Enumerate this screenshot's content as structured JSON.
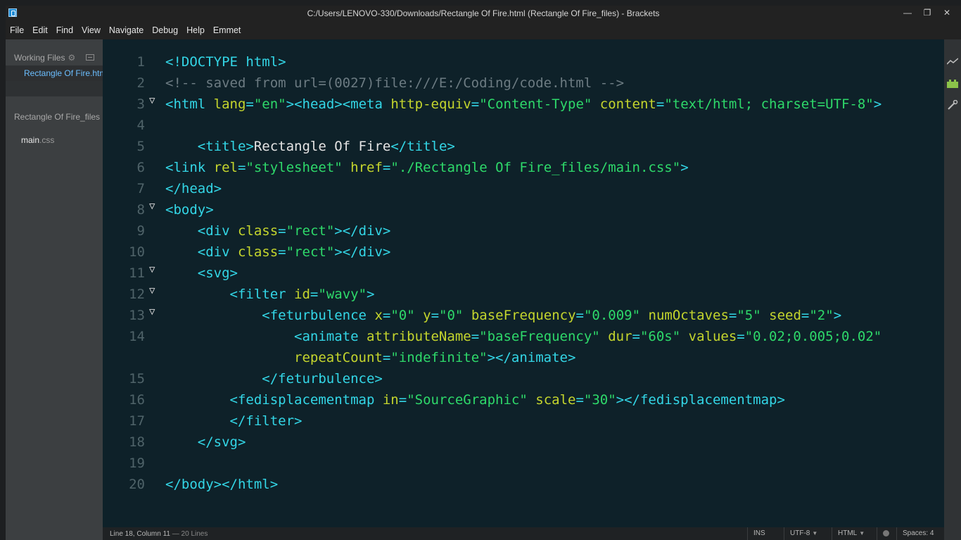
{
  "window": {
    "title": "C:/Users/LENOVO-330/Downloads/Rectangle Of Fire.html (Rectangle Of Fire_files) - Brackets",
    "controls": {
      "minimize": "—",
      "maximize": "❐",
      "close": "✕"
    }
  },
  "menu": {
    "items": [
      "File",
      "Edit",
      "Find",
      "View",
      "Navigate",
      "Debug",
      "Help",
      "Emmet"
    ]
  },
  "sidebar": {
    "working_files_label": "Working Files",
    "working_files": [
      "Rectangle Of Fire.html"
    ],
    "project_title": "Rectangle Of Fire_files",
    "files": [
      {
        "name": "main",
        "ext": ".css"
      }
    ]
  },
  "editor": {
    "lines": [
      {
        "num": "1",
        "fold": "",
        "tokens": [
          [
            "t",
            "<!DOCTYPE html>"
          ]
        ]
      },
      {
        "num": "2",
        "fold": "",
        "tokens": [
          [
            "c",
            "<!-- saved from url=(0027)file:///E:/Coding/code.html -->"
          ]
        ]
      },
      {
        "num": "3",
        "fold": "▽",
        "tokens": [
          [
            "t",
            "<html "
          ],
          [
            "a",
            "lang"
          ],
          [
            "t",
            "="
          ],
          [
            "s",
            "\"en\""
          ],
          [
            "t",
            "><head><meta "
          ],
          [
            "a",
            "http-equiv"
          ],
          [
            "t",
            "="
          ],
          [
            "s",
            "\"Content-Type\""
          ],
          [
            "x",
            " "
          ],
          [
            "a",
            "content"
          ],
          [
            "t",
            "="
          ],
          [
            "s",
            "\"text/html; charset=UTF-8\""
          ],
          [
            "t",
            ">"
          ]
        ]
      },
      {
        "num": "4",
        "fold": "",
        "tokens": []
      },
      {
        "num": "5",
        "fold": "",
        "tokens": [
          [
            "x",
            "    "
          ],
          [
            "t",
            "<title>"
          ],
          [
            "x",
            "Rectangle Of Fire"
          ],
          [
            "t",
            "</title>"
          ]
        ]
      },
      {
        "num": "6",
        "fold": "",
        "tokens": [
          [
            "t",
            "<link "
          ],
          [
            "a",
            "rel"
          ],
          [
            "t",
            "="
          ],
          [
            "s",
            "\"stylesheet\""
          ],
          [
            "x",
            " "
          ],
          [
            "a",
            "href"
          ],
          [
            "t",
            "="
          ],
          [
            "s",
            "\"./Rectangle Of Fire_files/main.css\""
          ],
          [
            "t",
            ">"
          ]
        ]
      },
      {
        "num": "7",
        "fold": "",
        "tokens": [
          [
            "t",
            "</head>"
          ]
        ]
      },
      {
        "num": "8",
        "fold": "▽",
        "tokens": [
          [
            "t",
            "<body>"
          ]
        ]
      },
      {
        "num": "9",
        "fold": "",
        "tokens": [
          [
            "x",
            "    "
          ],
          [
            "t",
            "<div "
          ],
          [
            "a",
            "class"
          ],
          [
            "t",
            "="
          ],
          [
            "s",
            "\"rect\""
          ],
          [
            "t",
            "></div>"
          ]
        ]
      },
      {
        "num": "10",
        "fold": "",
        "tokens": [
          [
            "x",
            "    "
          ],
          [
            "t",
            "<div "
          ],
          [
            "a",
            "class"
          ],
          [
            "t",
            "="
          ],
          [
            "s",
            "\"rect\""
          ],
          [
            "t",
            "></div>"
          ]
        ]
      },
      {
        "num": "11",
        "fold": "▽",
        "tokens": [
          [
            "x",
            "    "
          ],
          [
            "t",
            "<svg>"
          ]
        ]
      },
      {
        "num": "12",
        "fold": "▽",
        "tokens": [
          [
            "x",
            "        "
          ],
          [
            "t",
            "<filter "
          ],
          [
            "a",
            "id"
          ],
          [
            "t",
            "="
          ],
          [
            "s",
            "\"wavy\""
          ],
          [
            "t",
            ">"
          ]
        ]
      },
      {
        "num": "13",
        "fold": "▽",
        "tokens": [
          [
            "x",
            "            "
          ],
          [
            "t",
            "<feturbulence "
          ],
          [
            "a",
            "x"
          ],
          [
            "t",
            "="
          ],
          [
            "s",
            "\"0\""
          ],
          [
            "x",
            " "
          ],
          [
            "a",
            "y"
          ],
          [
            "t",
            "="
          ],
          [
            "s",
            "\"0\""
          ],
          [
            "x",
            " "
          ],
          [
            "a",
            "baseFrequency"
          ],
          [
            "t",
            "="
          ],
          [
            "s",
            "\"0.009\""
          ],
          [
            "x",
            " "
          ],
          [
            "a",
            "numOctaves"
          ],
          [
            "t",
            "="
          ],
          [
            "s",
            "\"5\""
          ],
          [
            "x",
            " "
          ],
          [
            "a",
            "seed"
          ],
          [
            "t",
            "="
          ],
          [
            "s",
            "\"2\""
          ],
          [
            "t",
            ">"
          ]
        ]
      },
      {
        "num": "14",
        "fold": "",
        "tokens": [
          [
            "x",
            "                "
          ],
          [
            "t",
            "<animate "
          ],
          [
            "a",
            "attributeName"
          ],
          [
            "t",
            "="
          ],
          [
            "s",
            "\"baseFrequency\""
          ],
          [
            "x",
            " "
          ],
          [
            "a",
            "dur"
          ],
          [
            "t",
            "="
          ],
          [
            "s",
            "\"60s\""
          ],
          [
            "x",
            " "
          ],
          [
            "a",
            "values"
          ],
          [
            "t",
            "="
          ],
          [
            "s",
            "\"0.02;0.005;0.02\""
          ]
        ]
      },
      {
        "num": "",
        "fold": "",
        "tokens": [
          [
            "x",
            "                "
          ],
          [
            "a",
            "repeatCount"
          ],
          [
            "t",
            "="
          ],
          [
            "s",
            "\"indefinite\""
          ],
          [
            "t",
            "></animate>"
          ]
        ]
      },
      {
        "num": "15",
        "fold": "",
        "tokens": [
          [
            "x",
            "            "
          ],
          [
            "t",
            "</feturbulence>"
          ]
        ]
      },
      {
        "num": "16",
        "fold": "",
        "tokens": [
          [
            "x",
            "        "
          ],
          [
            "t",
            "<fedisplacementmap "
          ],
          [
            "a",
            "in"
          ],
          [
            "t",
            "="
          ],
          [
            "s",
            "\"SourceGraphic\""
          ],
          [
            "x",
            " "
          ],
          [
            "a",
            "scale"
          ],
          [
            "t",
            "="
          ],
          [
            "s",
            "\"30\""
          ],
          [
            "t",
            "></fedisplacementmap>"
          ]
        ]
      },
      {
        "num": "17",
        "fold": "",
        "tokens": [
          [
            "x",
            "        "
          ],
          [
            "t",
            "</filter>"
          ]
        ]
      },
      {
        "num": "18",
        "fold": "",
        "tokens": [
          [
            "x",
            "    "
          ],
          [
            "t",
            "</svg>"
          ]
        ]
      },
      {
        "num": "19",
        "fold": "",
        "tokens": []
      },
      {
        "num": "20",
        "fold": "",
        "tokens": [
          [
            "t",
            "</body></html>"
          ]
        ]
      }
    ]
  },
  "right_toolbar": {
    "icons": [
      "live-preview-icon",
      "extension-manager-icon",
      "wrench-icon"
    ]
  },
  "status": {
    "cursor": "Line 18, Column 11",
    "sep": " — ",
    "lines": "20 Lines",
    "ins": "INS",
    "encoding": "UTF-8",
    "language": "HTML",
    "spaces": "Spaces: 4"
  },
  "colors": {
    "tag": "#33d6e6",
    "attribute": "#c4d52d",
    "string": "#2ed96a",
    "text": "#e4e4e4",
    "comment": "#6c7b82",
    "editor_bg": "#0e2129",
    "sidebar_bg": "#3c3f41",
    "active_file": "#6bbeff"
  }
}
